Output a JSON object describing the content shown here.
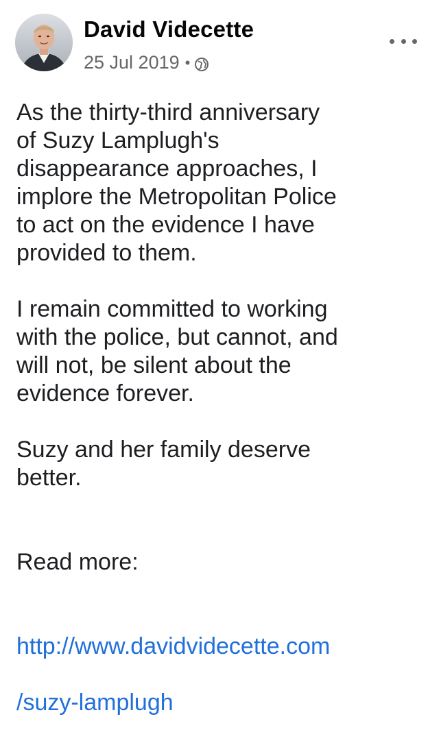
{
  "post": {
    "author": "David Videcette",
    "date": "25 Jul 2019",
    "separator": "•",
    "privacy_icon": "globe-icon",
    "more_icon": "more-options-icon",
    "paragraphs": [
      "As the thirty-third anniversary\nof Suzy Lamplugh's\ndisappearance approaches, I\nimplore the Metropolitan Police\nto act on the evidence I have\nprovided to them.",
      "I remain committed to working\nwith the police, but cannot, and\nwill not, be silent about the\nevidence forever.",
      "Suzy and her family deserve\nbetter."
    ],
    "read_more_label": "Read more:",
    "link_line1": "http://www.davidvidecette.com",
    "link_line2": "/suzy-lamplugh"
  },
  "colors": {
    "text": "#1c1e21",
    "meta": "#65676b",
    "link": "#216fdb"
  }
}
